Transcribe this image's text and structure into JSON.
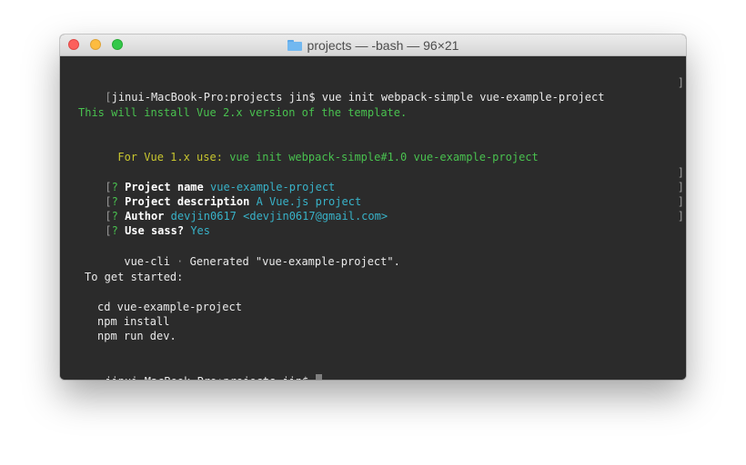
{
  "window": {
    "title": "projects — -bash — 96×21",
    "folder_icon": "folder-icon"
  },
  "colors": {
    "background": "#2b2b2b",
    "text": "#eaeaea",
    "green": "#49c14f",
    "yellow": "#c9c72f",
    "cyan": "#38b2c8"
  },
  "terminal": {
    "prompt": "jinui-MacBook-Pro:projects jin$",
    "command": "vue init webpack-simple vue-example-project",
    "info_line": "This will install Vue 2.x version of the template.",
    "vue1_label": "For Vue 1.x use:",
    "vue1_command": "vue init webpack-simple#1.0 vue-example-project",
    "answers": [
      {
        "mark": "?",
        "label": "Project name",
        "value": "vue-example-project"
      },
      {
        "mark": "?",
        "label": "Project description",
        "value": "A Vue.js project"
      },
      {
        "mark": "?",
        "label": "Author",
        "value": "devjin0617 <devjin0617@gmail.com>"
      },
      {
        "mark": "?",
        "label": "Use sass?",
        "value": "Yes"
      }
    ],
    "generated_tool": "vue-cli",
    "generated_sep": "·",
    "generated_text": "Generated \"vue-example-project\".",
    "get_started": "To get started:",
    "steps": [
      "cd vue-example-project",
      "npm install",
      "npm run dev."
    ]
  }
}
